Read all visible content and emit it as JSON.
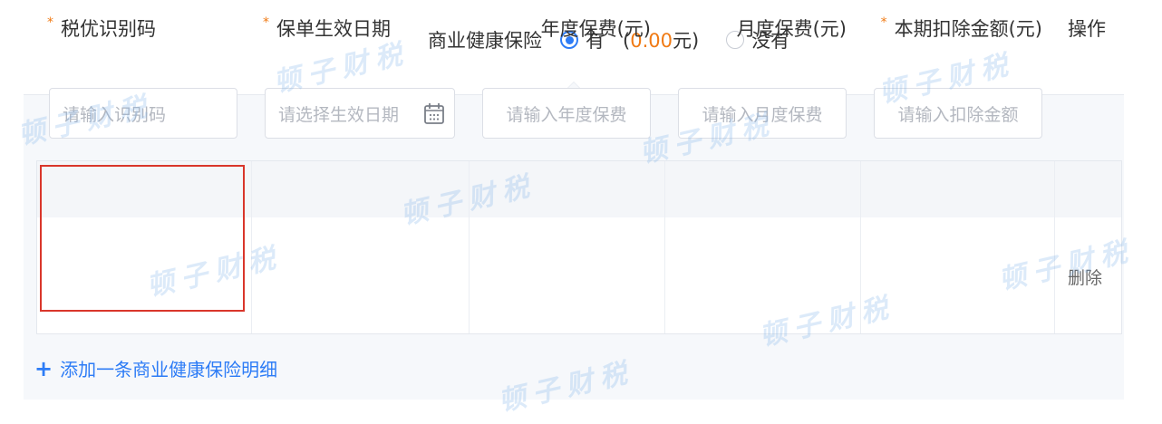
{
  "insurance": {
    "label": "商业健康保险",
    "option_yes": "有",
    "amount_open": "(",
    "amount_value": "0.00",
    "amount_close": "元)",
    "option_no": "没有",
    "selected": "有"
  },
  "table": {
    "headers": {
      "tax_code": "税优识别码",
      "effective_date": "保单生效日期",
      "annual_premium": "年度保费(元)",
      "monthly_premium": "月度保费(元)",
      "deduction_amount": "本期扣除金额(元)",
      "actions": "操作"
    },
    "placeholders": {
      "tax_code": "请输入识别码",
      "effective_date": "请选择生效日期",
      "annual_premium": "请输入年度保费",
      "monthly_premium": "请输入月度保费",
      "deduction_amount": "请输入扣除金额"
    },
    "delete_label": "删除"
  },
  "add_link": {
    "plus": "+",
    "label": "添加一条商业健康保险明细"
  },
  "watermark": "顿子财税",
  "colors": {
    "accent_blue": "#2d7cf6",
    "amount_orange": "#f07a14",
    "highlight_red": "#d9362b",
    "required_mark": "#f07a14"
  }
}
